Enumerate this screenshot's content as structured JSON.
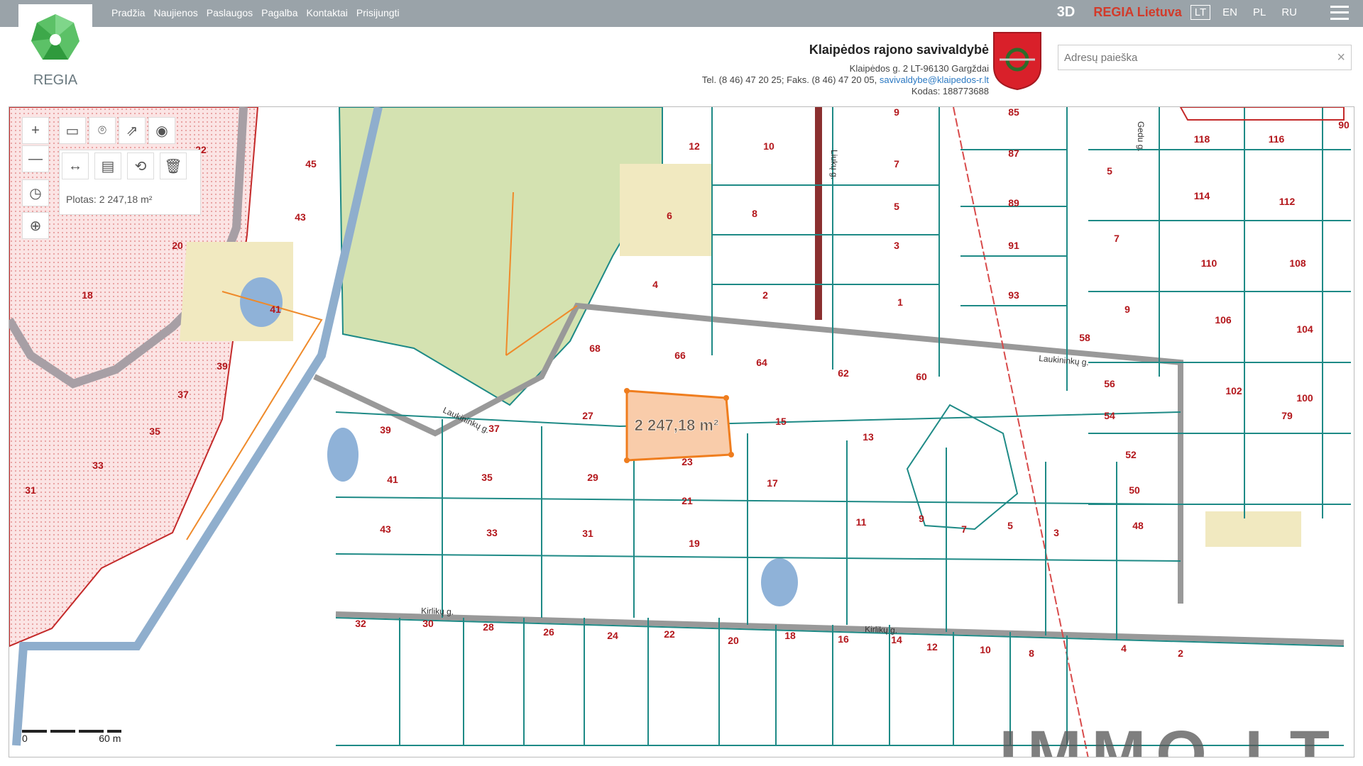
{
  "header": {
    "logo_text": "REGIA",
    "nav": [
      "Pradžia",
      "Naujienos",
      "Paslaugos",
      "Pagalba",
      "Kontaktai",
      "Prisijungti"
    ],
    "btn_3d": "3D",
    "regia_lietuva": "REGIA Lietuva",
    "languages": [
      "LT",
      "EN",
      "PL",
      "RU"
    ],
    "active_language": "LT"
  },
  "municipality": {
    "name": "Klaipėdos rajono savivaldybė",
    "address": "Klaipėdos g. 2 LT-96130 Gargždai",
    "phone_fax": "Tel. (8 46) 47 20 25; Faks. (8 46) 47 20 05,",
    "email": "savivaldybe@klaipedos-r.lt",
    "code": "Kodas: 188773688"
  },
  "search": {
    "placeholder": "Adresų paieška",
    "clear": "×"
  },
  "tools": {
    "zoom_in": "+",
    "zoom_out": "—",
    "area_label": "Plotas: 2 247,18 m²"
  },
  "map": {
    "selected_area": "2 247,18 m²",
    "scale_start": "0",
    "scale_label": "60 m",
    "watermark": "IMMO.LT",
    "streets": [
      "Laukininkų g.",
      "Laukininkų g.",
      "Kirlikų g.",
      "Kirlikų g.",
      "Liukų g.",
      "Gedu g."
    ],
    "lots": [
      {
        "n": "22"
      },
      {
        "n": "45"
      },
      {
        "n": "43"
      },
      {
        "n": "20"
      },
      {
        "n": "18"
      },
      {
        "n": "41"
      },
      {
        "n": "39"
      },
      {
        "n": "37"
      },
      {
        "n": "35"
      },
      {
        "n": "33"
      },
      {
        "n": "31"
      },
      {
        "n": "12"
      },
      {
        "n": "10"
      },
      {
        "n": "6"
      },
      {
        "n": "8"
      },
      {
        "n": "4"
      },
      {
        "n": "2"
      },
      {
        "n": "9"
      },
      {
        "n": "7"
      },
      {
        "n": "5"
      },
      {
        "n": "3"
      },
      {
        "n": "1"
      },
      {
        "n": "85"
      },
      {
        "n": "87"
      },
      {
        "n": "89"
      },
      {
        "n": "91"
      },
      {
        "n": "93"
      },
      {
        "n": "5"
      },
      {
        "n": "7"
      },
      {
        "n": "9"
      },
      {
        "n": "118"
      },
      {
        "n": "116"
      },
      {
        "n": "114"
      },
      {
        "n": "112"
      },
      {
        "n": "110"
      },
      {
        "n": "108"
      },
      {
        "n": "106"
      },
      {
        "n": "104"
      },
      {
        "n": "102"
      },
      {
        "n": "100"
      },
      {
        "n": "79"
      },
      {
        "n": "68"
      },
      {
        "n": "66"
      },
      {
        "n": "64"
      },
      {
        "n": "62"
      },
      {
        "n": "60"
      },
      {
        "n": "58"
      },
      {
        "n": "27"
      },
      {
        "n": "15"
      },
      {
        "n": "13"
      },
      {
        "n": "56"
      },
      {
        "n": "54"
      },
      {
        "n": "39"
      },
      {
        "n": "37"
      },
      {
        "n": "23"
      },
      {
        "n": "41"
      },
      {
        "n": "35"
      },
      {
        "n": "29"
      },
      {
        "n": "21"
      },
      {
        "n": "17"
      },
      {
        "n": "11"
      },
      {
        "n": "9"
      },
      {
        "n": "7"
      },
      {
        "n": "5"
      },
      {
        "n": "3"
      },
      {
        "n": "52"
      },
      {
        "n": "50"
      },
      {
        "n": "48"
      },
      {
        "n": "43"
      },
      {
        "n": "33"
      },
      {
        "n": "31"
      },
      {
        "n": "19"
      },
      {
        "n": "32"
      },
      {
        "n": "30"
      },
      {
        "n": "28"
      },
      {
        "n": "26"
      },
      {
        "n": "24"
      },
      {
        "n": "22"
      },
      {
        "n": "20"
      },
      {
        "n": "18"
      },
      {
        "n": "16"
      },
      {
        "n": "14"
      },
      {
        "n": "12"
      },
      {
        "n": "10"
      },
      {
        "n": "8"
      },
      {
        "n": "4"
      },
      {
        "n": "2"
      },
      {
        "n": "90"
      }
    ]
  }
}
